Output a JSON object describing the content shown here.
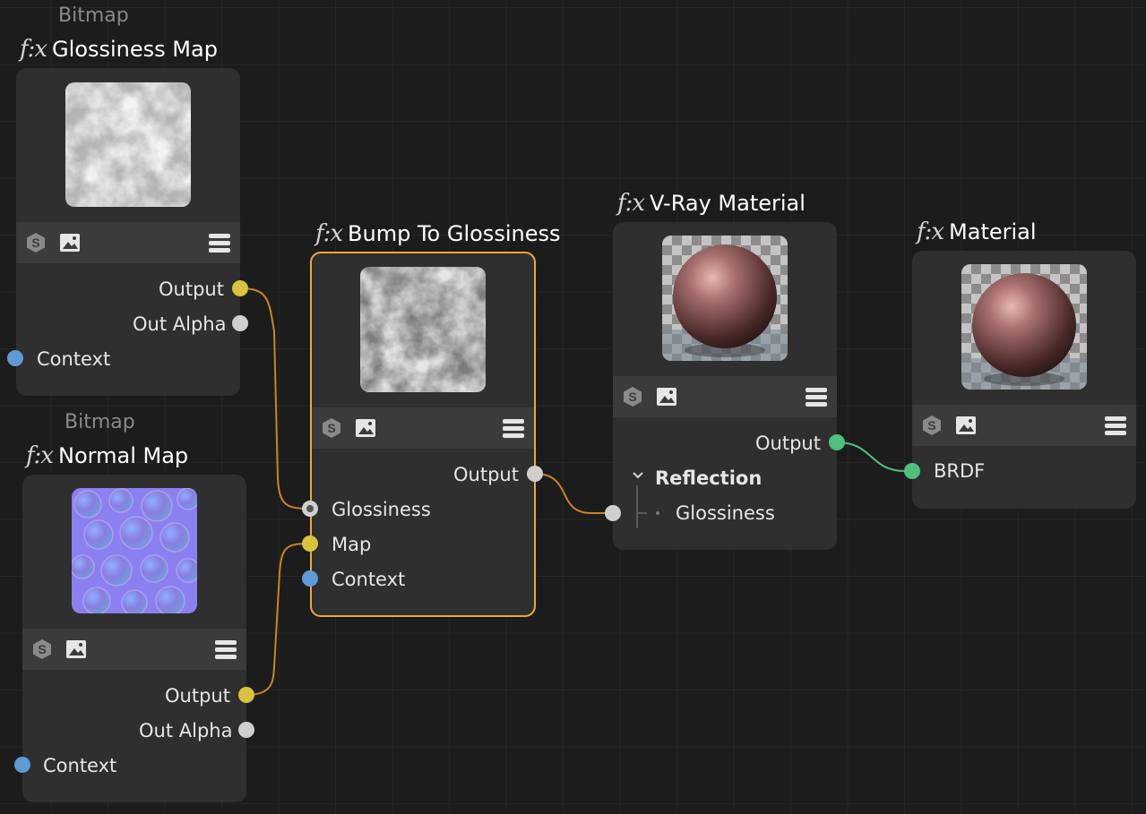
{
  "nodes": {
    "glossiness_map": {
      "prefix": "Bitmap",
      "fx": "f:x",
      "title": "Glossiness Map",
      "outputs": [
        "Output",
        "Out Alpha"
      ],
      "inputs": [
        "Context"
      ]
    },
    "normal_map": {
      "prefix": "Bitmap",
      "fx": "f:x",
      "title": "Normal Map",
      "outputs": [
        "Output",
        "Out Alpha"
      ],
      "inputs": [
        "Context"
      ]
    },
    "bump_to_glossiness": {
      "fx": "f:x",
      "title": "Bump To Glossiness",
      "outputs": [
        "Output"
      ],
      "inputs": [
        "Glossiness",
        "Map",
        "Context"
      ]
    },
    "vray_material": {
      "fx": "f:x",
      "title": "V-Ray Material",
      "outputs": [
        "Output"
      ],
      "group": "Reflection",
      "group_inputs": [
        "Glossiness"
      ]
    },
    "material": {
      "fx": "f:x",
      "title": "Material",
      "inputs": [
        "BRDF"
      ]
    }
  },
  "icons": {
    "shader": "s-logo-icon",
    "image": "image-icon",
    "menu": "hamburger-menu-icon",
    "collapse": "chevron-down-icon"
  },
  "colors": {
    "selection": "#f0a83a",
    "port_yellow": "#d9c23e",
    "port_grey": "#cfcfcf",
    "port_blue": "#5f9ad6",
    "port_green": "#4fbf7e"
  }
}
